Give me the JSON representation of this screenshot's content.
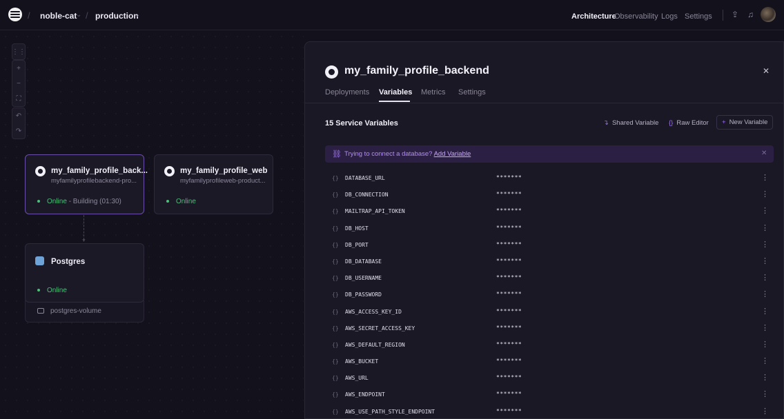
{
  "header": {
    "project": "noble-cat",
    "environment": "production",
    "nav": [
      "Architecture",
      "Observability",
      "Logs",
      "Settings"
    ],
    "active_nav": "Architecture"
  },
  "canvas": {
    "tools": [
      "grid-icon",
      "zoom-in-icon",
      "zoom-out-icon",
      "fit-view-icon",
      "undo-icon",
      "redo-icon"
    ],
    "services": [
      {
        "name": "my_family_profile_back...",
        "domain": "myfamilyprofilebackend-pro...",
        "status": "Online",
        "status_detail": "- Building (01:30)"
      },
      {
        "name": "my_family_profile_web",
        "domain": "myfamilyprofileweb-product...",
        "status": "Online"
      }
    ],
    "database": {
      "name": "Postgres",
      "status": "Online",
      "volume": "postgres-volume"
    }
  },
  "panel": {
    "title": "my_family_profile_backend",
    "tabs": [
      "Deployments",
      "Variables",
      "Metrics",
      "Settings"
    ],
    "active_tab": "Variables",
    "variables_count_label": "15 Service Variables",
    "actions": {
      "shared": "Shared Variable",
      "raw": "Raw Editor",
      "new": "New Variable"
    },
    "hint": {
      "text": "Trying to connect a database?",
      "link": "Add Variable"
    },
    "masked_value": "*******",
    "variables": [
      "DATABASE_URL",
      "DB_CONNECTION",
      "MAILTRAP_API_TOKEN",
      "DB_HOST",
      "DB_PORT",
      "DB_DATABASE",
      "DB_USERNAME",
      "DB_PASSWORD",
      "AWS_ACCESS_KEY_ID",
      "AWS_SECRET_ACCESS_KEY",
      "AWS_DEFAULT_REGION",
      "AWS_BUCKET",
      "AWS_URL",
      "AWS_ENDPOINT",
      "AWS_USE_PATH_STYLE_ENDPOINT"
    ]
  },
  "colors": {
    "accent": "#9b6ef3",
    "online": "#4bc07a",
    "background": "#13111c"
  }
}
